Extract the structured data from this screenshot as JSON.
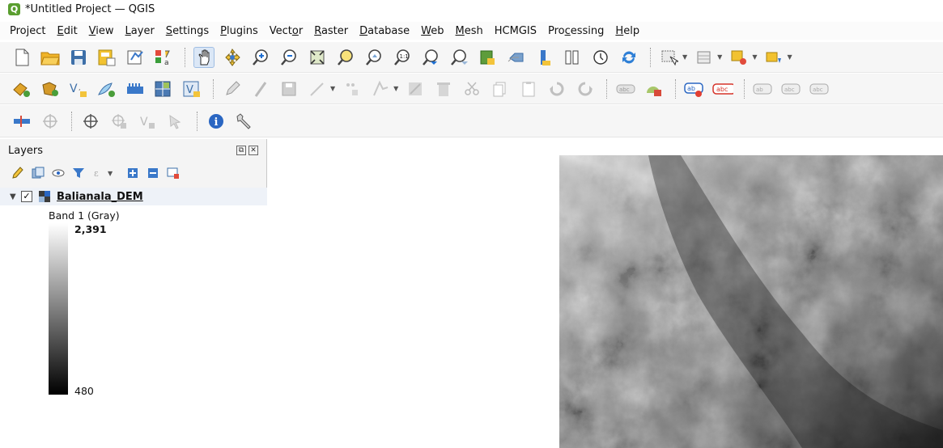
{
  "window": {
    "title": "*Untitled Project — QGIS"
  },
  "menu": [
    {
      "label": "Project",
      "key": ""
    },
    {
      "label": "Edit",
      "key": "E"
    },
    {
      "label": "View",
      "key": "V"
    },
    {
      "label": "Layer",
      "key": "L"
    },
    {
      "label": "Settings",
      "key": "S"
    },
    {
      "label": "Plugins",
      "key": "P"
    },
    {
      "label": "Vector",
      "key": "o"
    },
    {
      "label": "Raster",
      "key": "R"
    },
    {
      "label": "Database",
      "key": "D"
    },
    {
      "label": "Web",
      "key": "W"
    },
    {
      "label": "Mesh",
      "key": "M"
    },
    {
      "label": "HCMGIS",
      "key": ""
    },
    {
      "label": "Processing",
      "key": "c"
    },
    {
      "label": "Help",
      "key": "H"
    }
  ],
  "colors": {
    "accent_blue": "#2a66c2",
    "active_button": "#dbe7f6",
    "qgis_green": "#5a9e2f"
  },
  "layers_panel": {
    "title": "Layers",
    "layer": {
      "name": "Balianala_DEM",
      "checked": true,
      "band_label": "Band 1 (Gray)",
      "max": "2,391",
      "min": "480"
    }
  },
  "icons": {
    "toolbar1": [
      "new-project-icon",
      "open-project-icon",
      "save-project-icon",
      "save-as-icon",
      "print-layout-icon",
      "style-manager-icon",
      "pan-icon",
      "pan-to-selection-icon",
      "zoom-in-icon",
      "zoom-out-icon",
      "zoom-full-icon",
      "zoom-to-selection-icon",
      "zoom-to-layer-icon",
      "zoom-native-icon",
      "zoom-last-icon",
      "zoom-next-icon",
      "new-bookmark-icon",
      "show-bookmarks-icon",
      "new-map-view-icon",
      "temporal-controller-icon",
      "refresh-icon",
      "select-features-icon",
      "open-attribute-table-icon",
      "deselect-icon",
      "identify-dropdown-icon"
    ],
    "toolbar2": [
      "add-vector-layer-icon",
      "add-raster-layer-icon",
      "add-delimited-text-icon",
      "add-shapefile-icon",
      "add-wms-icon",
      "add-wfs-icon",
      "add-virtual-layer-icon",
      "toggle-editing-icon",
      "digitize-icon",
      "save-edits-icon",
      "add-line-icon",
      "vertex-tool-icon",
      "modify-attributes-icon",
      "delete-selected-icon",
      "cut-features-icon",
      "copy-features-icon",
      "paste-features-icon",
      "undo-icon",
      "redo-icon",
      "label-toolbar-icon",
      "layer-diagram-icon",
      "highlight-label-icon",
      "label-icon",
      "pin-label-icon",
      "show-hide-labels-icon",
      "move-label-icon"
    ]
  }
}
